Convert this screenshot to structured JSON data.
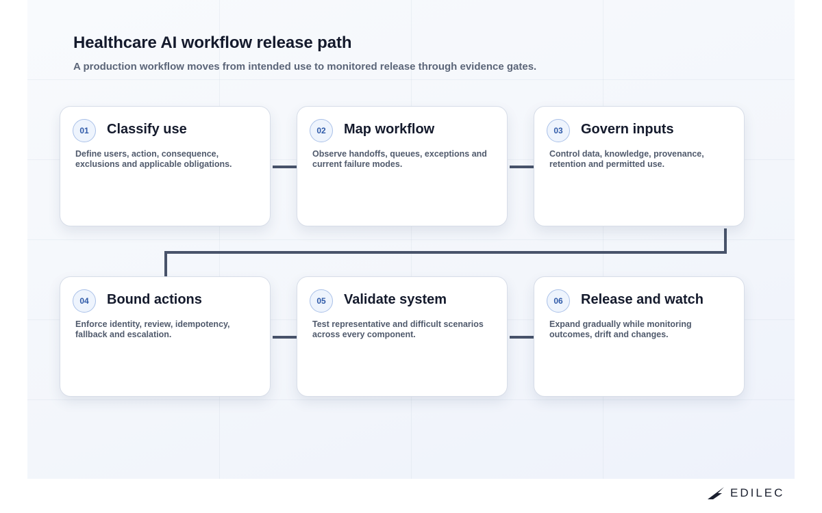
{
  "header": {
    "title": "Healthcare AI workflow release path",
    "subtitle": "A production workflow moves from intended use to monitored release through evidence gates."
  },
  "steps": [
    {
      "number": "01",
      "title": "Classify use",
      "description": "Define users, action, consequence, exclusions and applicable obligations."
    },
    {
      "number": "02",
      "title": "Map workflow",
      "description": "Observe handoffs, queues, exceptions and current failure modes."
    },
    {
      "number": "03",
      "title": "Govern inputs",
      "description": "Control data, knowledge, provenance, retention and permitted use."
    },
    {
      "number": "04",
      "title": "Bound actions",
      "description": "Enforce identity, review, idempotency, fallback and escalation."
    },
    {
      "number": "05",
      "title": "Validate system",
      "description": "Test representative and difficult scenarios across every component."
    },
    {
      "number": "06",
      "title": "Release and watch",
      "description": "Expand gradually while monitoring outcomes, drift and changes."
    }
  ],
  "brand": {
    "logo_text": "EDILEC",
    "logo_icon": "edilec-wing-icon"
  },
  "colors": {
    "connector": "#48536a",
    "badge_text": "#2f5aa8",
    "badge_border": "#a9c0e8",
    "title_text": "#141a2c"
  }
}
